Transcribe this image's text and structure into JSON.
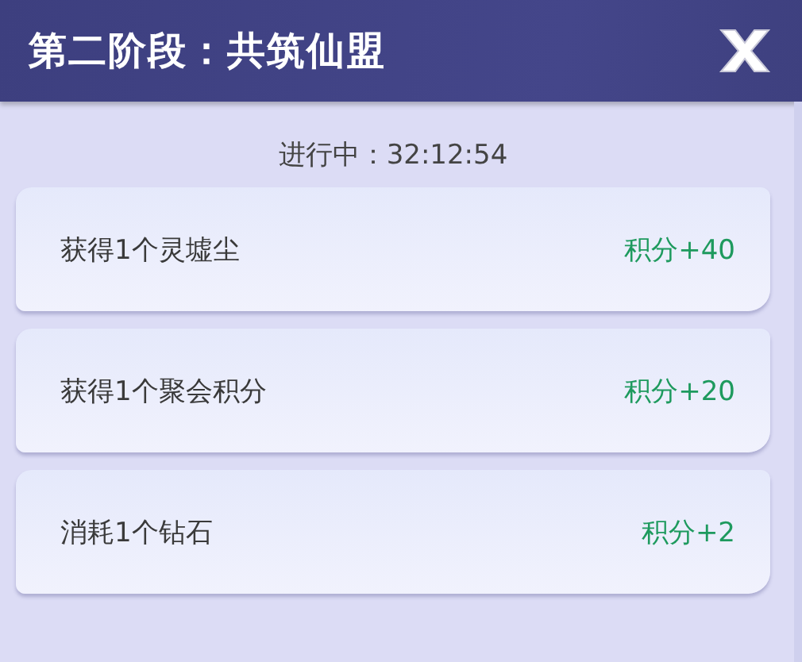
{
  "header": {
    "title": "第二阶段：共筑仙盟"
  },
  "timer": "进行中：32:12:54",
  "tasks": [
    {
      "label": "获得1个灵墟尘",
      "reward": "积分+40"
    },
    {
      "label": "获得1个聚会积分",
      "reward": "积分+20"
    },
    {
      "label": "消耗1个钻石",
      "reward": "积分+2"
    }
  ]
}
